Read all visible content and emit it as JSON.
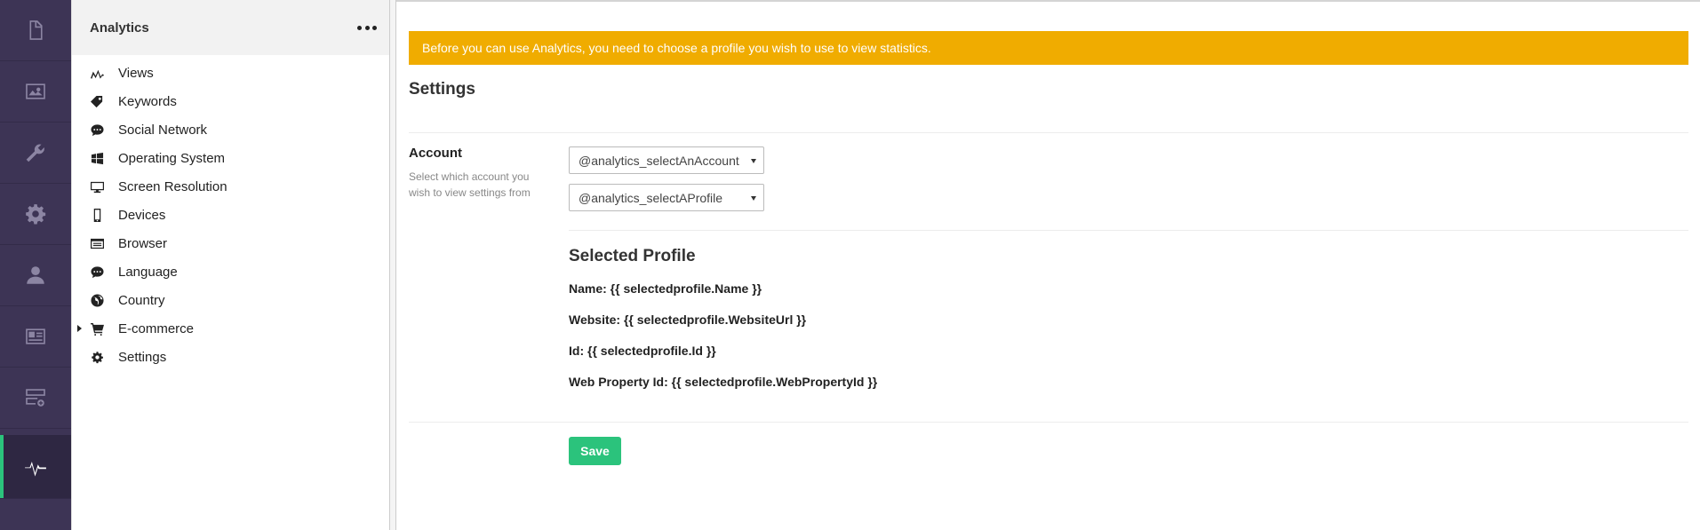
{
  "rail": {
    "items": [
      {
        "name": "content-section",
        "icon": "document-icon"
      },
      {
        "name": "media-section",
        "icon": "image-icon"
      },
      {
        "name": "settings-section",
        "icon": "wrench-icon"
      },
      {
        "name": "developer-section",
        "icon": "gear-icon"
      },
      {
        "name": "users-section",
        "icon": "user-icon"
      },
      {
        "name": "members-section",
        "icon": "id-card-icon"
      },
      {
        "name": "forms-section",
        "icon": "forms-icon"
      },
      {
        "name": "analytics-section",
        "icon": "pulse-icon",
        "active": true
      }
    ],
    "accent": "#2bc37c",
    "background": "#3d3455"
  },
  "tree": {
    "title": "Analytics",
    "items": [
      {
        "label": "Views",
        "icon": "chart-icon"
      },
      {
        "label": "Keywords",
        "icon": "tag-icon"
      },
      {
        "label": "Social Network",
        "icon": "chat-icon"
      },
      {
        "label": "Operating System",
        "icon": "windows-icon"
      },
      {
        "label": "Screen Resolution",
        "icon": "monitor-icon"
      },
      {
        "label": "Devices",
        "icon": "phone-icon"
      },
      {
        "label": "Browser",
        "icon": "browser-icon"
      },
      {
        "label": "Language",
        "icon": "chat-icon"
      },
      {
        "label": "Country",
        "icon": "globe-icon"
      },
      {
        "label": "E-commerce",
        "icon": "cart-icon",
        "expandable": true
      },
      {
        "label": "Settings",
        "icon": "gear-icon"
      }
    ]
  },
  "main": {
    "alert": "Before you can use Analytics, you need to choose a profile you wish to use to view statistics.",
    "alert_color": "#f0ac00",
    "heading": "Settings",
    "account_label": "Account",
    "account_desc": "Select which account you wish to view settings from",
    "account_select": "@analytics_selectAnAccount",
    "profile_select": "@analytics_selectAProfile",
    "selected_profile_heading": "Selected Profile",
    "name_line": "Name: {{ selectedprofile.Name }}",
    "website_line": "Website: {{ selectedprofile.WebsiteUrl }}",
    "id_line": "Id: {{ selectedprofile.Id }}",
    "web_property_line": "Web Property Id: {{ selectedprofile.WebPropertyId }}",
    "save_label": "Save",
    "save_color": "#2bc37c"
  }
}
